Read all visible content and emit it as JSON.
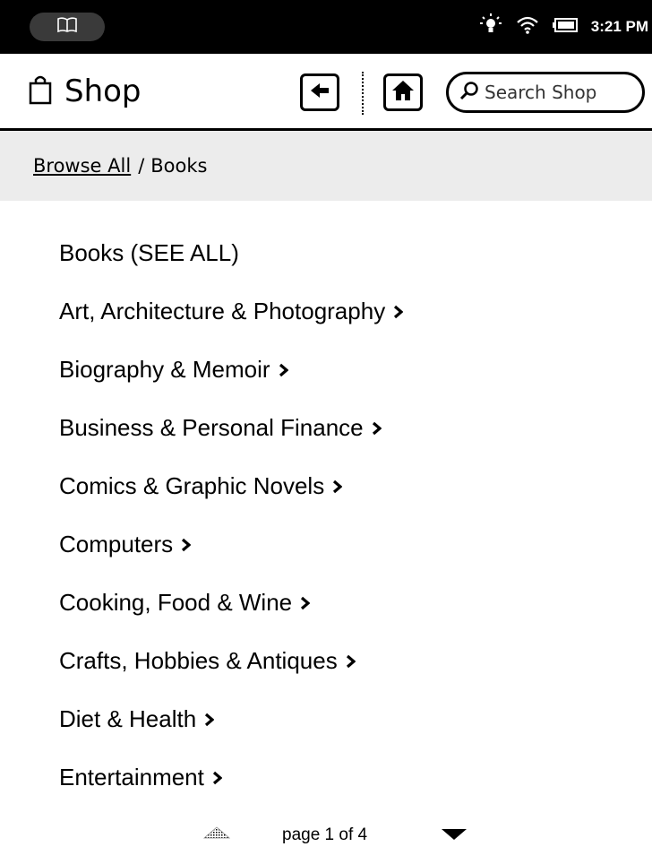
{
  "status_bar": {
    "library_icon": "book-icon",
    "light_icon": "glowlight-icon",
    "wifi_icon": "wifi-icon",
    "battery_icon": "battery-icon",
    "time": "3:21 PM"
  },
  "header": {
    "shop_icon": "shopping-bag-icon",
    "title": "Shop",
    "back_icon": "back-arrow-icon",
    "home_icon": "home-icon",
    "search_placeholder": "Search Shop",
    "search_icon": "search-icon"
  },
  "breadcrumb": {
    "link": "Browse All",
    "separator": "/",
    "current": "Books"
  },
  "categories": [
    {
      "label": "Books (SEE ALL)",
      "has_arrow": false
    },
    {
      "label": "Art, Architecture & Photography",
      "has_arrow": true
    },
    {
      "label": "Biography & Memoir",
      "has_arrow": true
    },
    {
      "label": "Business & Personal Finance",
      "has_arrow": true
    },
    {
      "label": "Comics & Graphic Novels",
      "has_arrow": true
    },
    {
      "label": "Computers",
      "has_arrow": true
    },
    {
      "label": "Cooking, Food & Wine",
      "has_arrow": true
    },
    {
      "label": "Crafts, Hobbies & Antiques",
      "has_arrow": true
    },
    {
      "label": "Diet & Health",
      "has_arrow": true
    },
    {
      "label": "Entertainment",
      "has_arrow": true
    }
  ],
  "pagination": {
    "text": "page 1 of 4",
    "current_page": 1,
    "total_pages": 4,
    "prev_enabled": false,
    "next_enabled": true
  }
}
